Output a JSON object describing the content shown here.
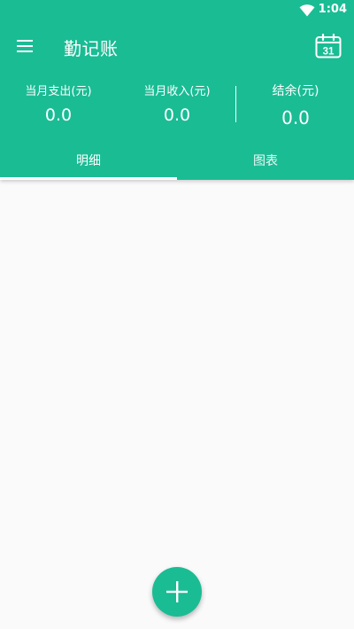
{
  "status_bar": {
    "time": "1:04",
    "wifi_icon": "wifi-icon"
  },
  "app_bar": {
    "title": "勤记账",
    "menu_icon": "hamburger-menu-icon",
    "calendar_icon": "calendar-icon",
    "calendar_day": "31"
  },
  "summary": {
    "expense_label": "当月支出(元)",
    "expense_value": "0.0",
    "income_label": "当月收入(元)",
    "income_value": "0.0",
    "balance_label": "结余(元)",
    "balance_value": "0.0"
  },
  "tabs": [
    {
      "label": "明细",
      "selected": true
    },
    {
      "label": "图表",
      "selected": false
    }
  ],
  "fab": {
    "icon": "plus-icon"
  },
  "colors": {
    "primary": "#1abc94",
    "background": "#fafafa",
    "on_primary": "#ffffff"
  }
}
